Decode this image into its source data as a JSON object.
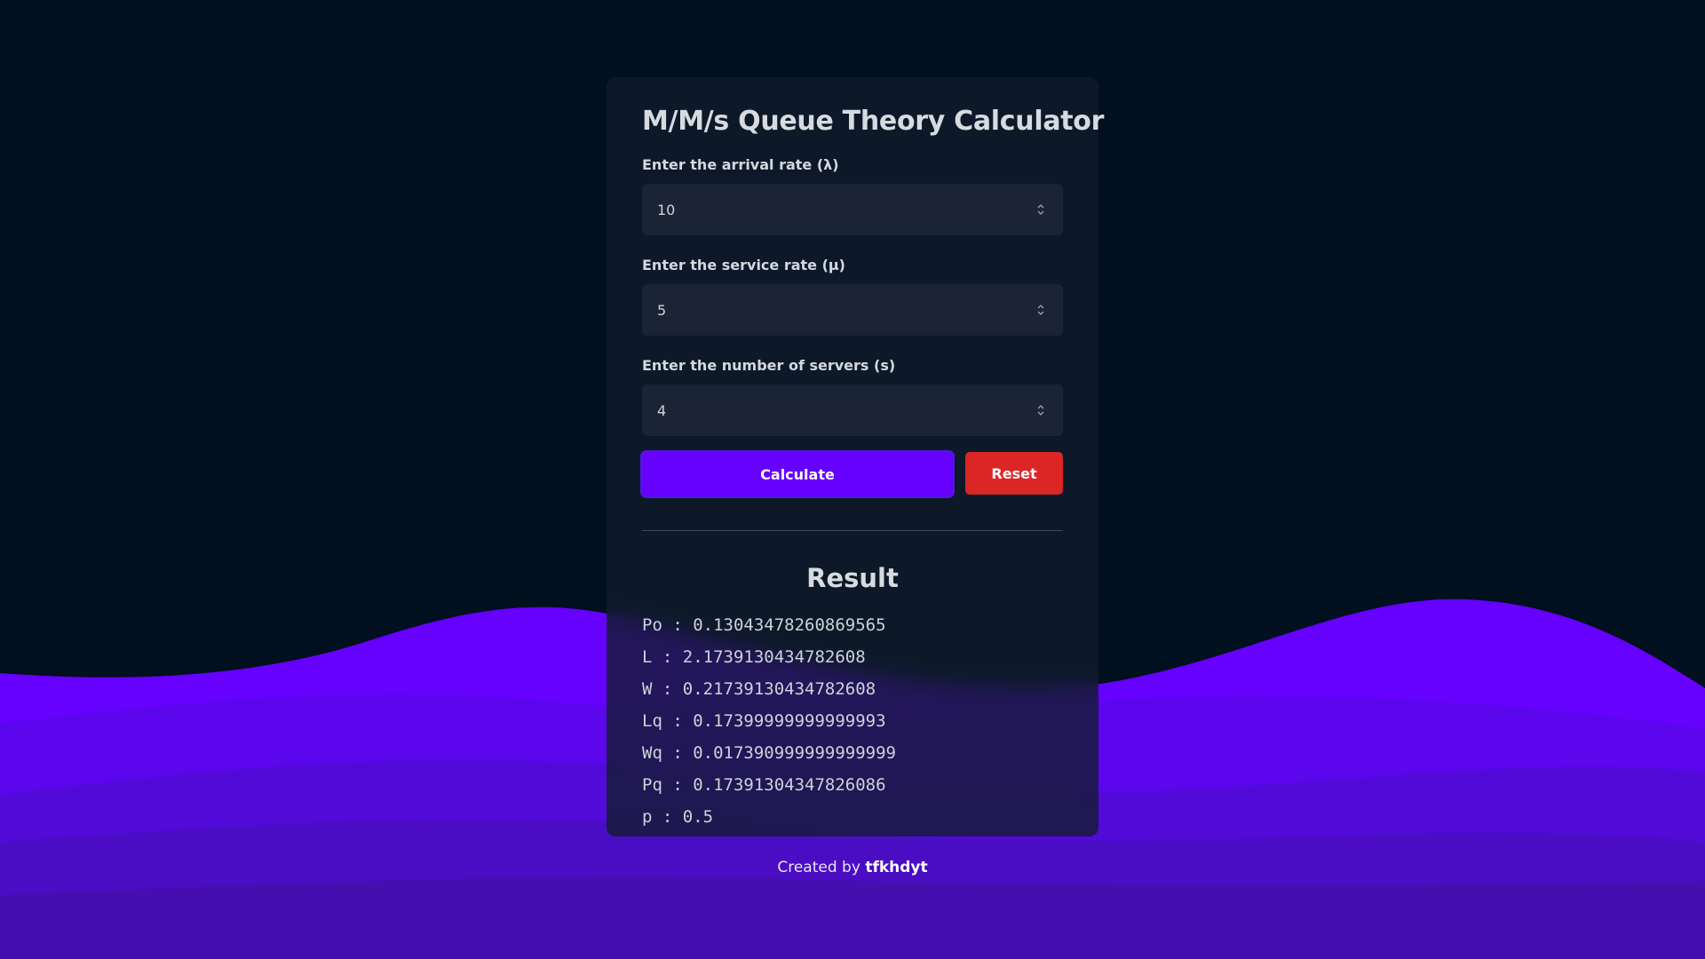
{
  "calculator": {
    "title": "M/M/s Queue Theory Calculator",
    "arrival": {
      "label": "Enter the arrival rate (λ)",
      "value": "10"
    },
    "service": {
      "label": "Enter the service rate (μ)",
      "value": "5"
    },
    "servers": {
      "label": "Enter the number of servers (s)",
      "value": "4"
    },
    "calculate_label": "Calculate",
    "reset_label": "Reset"
  },
  "result": {
    "title": "Result",
    "lines": [
      "Po : 0.13043478260869565",
      "L : 2.1739130434782608",
      "W : 0.21739130434782608",
      "Lq : 0.17399999999999993",
      "Wq : 0.017390999999999999",
      "Pq : 0.17391304347826086",
      "p : 0.5"
    ]
  },
  "footer": {
    "prefix": "Created by",
    "author": "tfkhdyt"
  },
  "colors": {
    "background": "#01101e",
    "accent": "#6600ff",
    "reset": "#dc2626"
  }
}
